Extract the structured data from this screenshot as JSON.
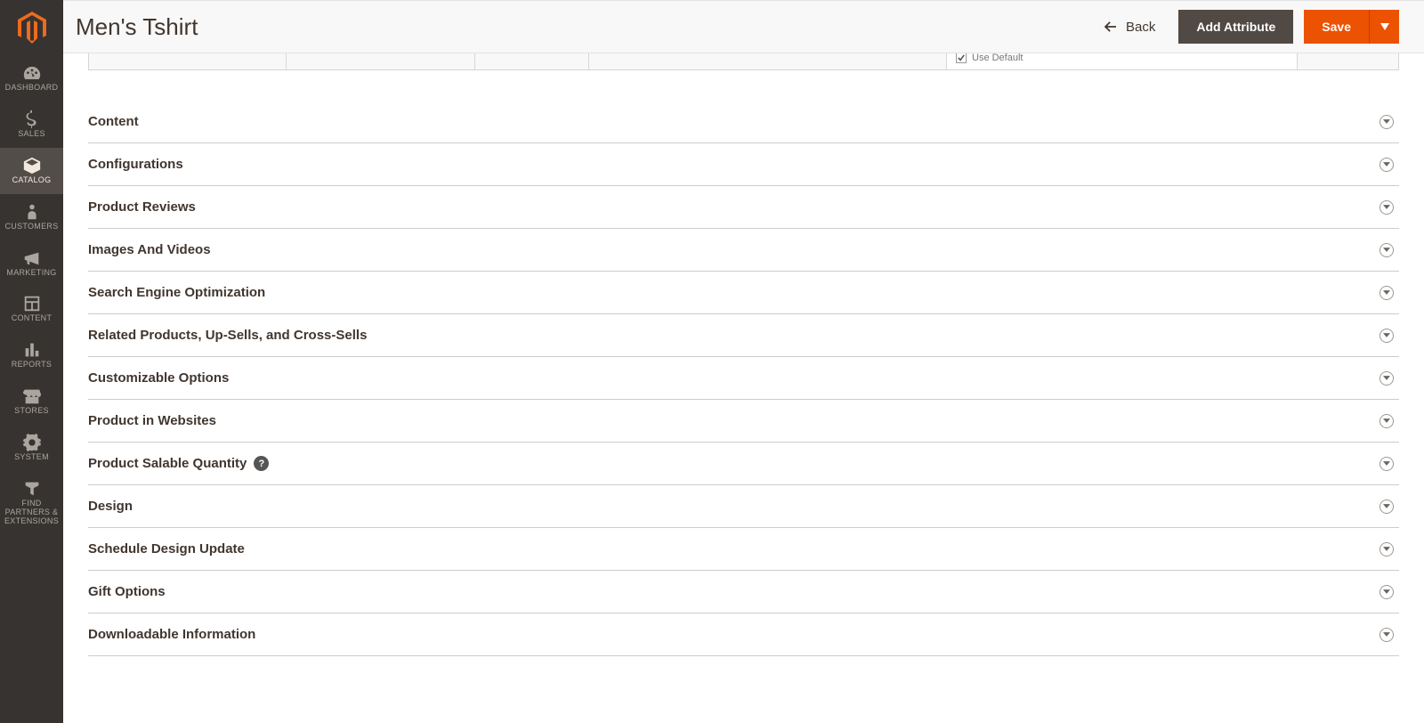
{
  "page": {
    "title": "Men's Tshirt"
  },
  "header": {
    "back": "Back",
    "add_attribute": "Add Attribute",
    "save": "Save"
  },
  "sidebar": {
    "items": [
      {
        "id": "dashboard",
        "label": "DASHBOARD"
      },
      {
        "id": "sales",
        "label": "SALES"
      },
      {
        "id": "catalog",
        "label": "CATALOG"
      },
      {
        "id": "customers",
        "label": "CUSTOMERS"
      },
      {
        "id": "marketing",
        "label": "MARKETING"
      },
      {
        "id": "content",
        "label": "CONTENT"
      },
      {
        "id": "reports",
        "label": "REPORTS"
      },
      {
        "id": "stores",
        "label": "STORES"
      },
      {
        "id": "system",
        "label": "SYSTEM"
      },
      {
        "id": "partners",
        "label": "FIND PARTNERS & EXTENSIONS"
      }
    ]
  },
  "partial_row": {
    "use_default": "Use Default",
    "checked": true
  },
  "sections": [
    {
      "label": "Content",
      "help": false
    },
    {
      "label": "Configurations",
      "help": false
    },
    {
      "label": "Product Reviews",
      "help": false
    },
    {
      "label": "Images And Videos",
      "help": false
    },
    {
      "label": "Search Engine Optimization",
      "help": false
    },
    {
      "label": "Related Products, Up-Sells, and Cross-Sells",
      "help": false
    },
    {
      "label": "Customizable Options",
      "help": false
    },
    {
      "label": "Product in Websites",
      "help": false
    },
    {
      "label": "Product Salable Quantity",
      "help": true
    },
    {
      "label": "Design",
      "help": false
    },
    {
      "label": "Schedule Design Update",
      "help": false
    },
    {
      "label": "Gift Options",
      "help": false
    },
    {
      "label": "Downloadable Information",
      "help": false
    }
  ]
}
